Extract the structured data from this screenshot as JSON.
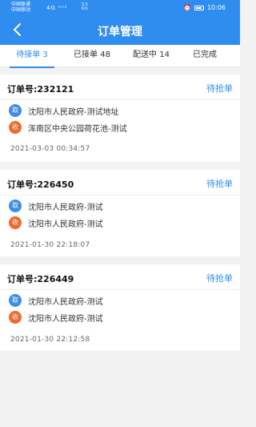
{
  "statusbar": {
    "carrier1": "中国联通",
    "carrier2": "中国移动",
    "signal": "4G ᵃᵘᵃ",
    "speed1": "5.5",
    "speed2": "K/s",
    "battery_pct": "",
    "time": "10:06"
  },
  "header": {
    "title": "订单管理",
    "back_icon": "chevron-left-icon"
  },
  "tabs": [
    {
      "label": "待接单 3"
    },
    {
      "label": "已接单 48"
    },
    {
      "label": "配送中 14"
    },
    {
      "label": "已完成"
    }
  ],
  "orders": [
    {
      "order_no": "订单号:232121",
      "status": "待抢单",
      "pick_badge": "取",
      "pick_addr": "沈阳市人民政府-测试地址",
      "recv_badge": "收",
      "recv_addr": "浑南区中央公园荷花池-测试",
      "time": "2021-03-03 00:34:57"
    },
    {
      "order_no": "订单号:226450",
      "status": "待抢单",
      "pick_badge": "取",
      "pick_addr": "沈阳市人民政府-测试",
      "recv_badge": "收",
      "recv_addr": "沈阳市人民政府-测试",
      "time": "2021-01-30 22:18:07"
    },
    {
      "order_no": "订单号:226449",
      "status": "待抢单",
      "pick_badge": "取",
      "pick_addr": "沈阳市人民政府-测试",
      "recv_badge": "收",
      "recv_addr": "沈阳市人民政府-测试",
      "time": "2021-01-30 22:12:58"
    }
  ],
  "colors": {
    "accent": "#2f8df0",
    "pick": "#3d8ee8",
    "recv": "#ee6b2e"
  }
}
